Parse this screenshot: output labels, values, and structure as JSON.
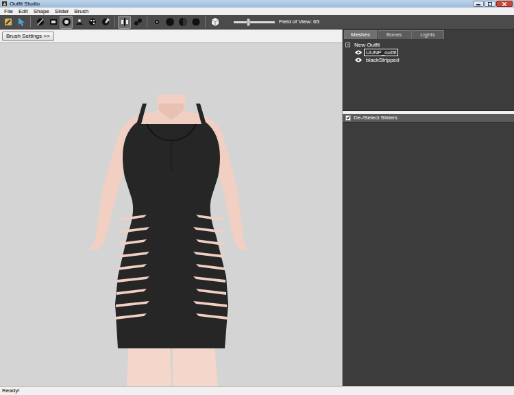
{
  "window": {
    "title": "Outfit Studio"
  },
  "menu": [
    "File",
    "Edit",
    "Shape",
    "Slider",
    "Brush"
  ],
  "toolbar": {
    "tools": [
      {
        "selected": false
      },
      {
        "selected": false
      },
      {
        "selected": false
      },
      {
        "selected": false
      },
      {
        "selected": true
      },
      {
        "selected": false
      },
      {
        "selected": false
      },
      {
        "selected": false
      },
      {
        "selected": true
      },
      {
        "selected": false
      },
      {
        "selected": false
      },
      {
        "selected": false
      },
      {
        "selected": false
      },
      {
        "selected": false
      },
      {
        "selected": false
      }
    ],
    "fov": {
      "level": 0.35,
      "label": "Field of View: 65"
    }
  },
  "brush_settings": "Brush Settings >>",
  "tabs": [
    {
      "label": "Meshes",
      "selected": true
    },
    {
      "label": "Bones",
      "selected": false
    },
    {
      "label": "Lights",
      "selected": false
    }
  ],
  "tree": {
    "root": {
      "label": "New Outfit",
      "expanded": true
    },
    "items": [
      {
        "label": "UUNP_outfit",
        "selected": true,
        "visible": true
      },
      {
        "label": "blackStripped",
        "selected": false,
        "visible": true
      }
    ]
  },
  "sliders": {
    "label": "De-/Select Sliders",
    "checked": true
  },
  "status_bar": "Ready!"
}
